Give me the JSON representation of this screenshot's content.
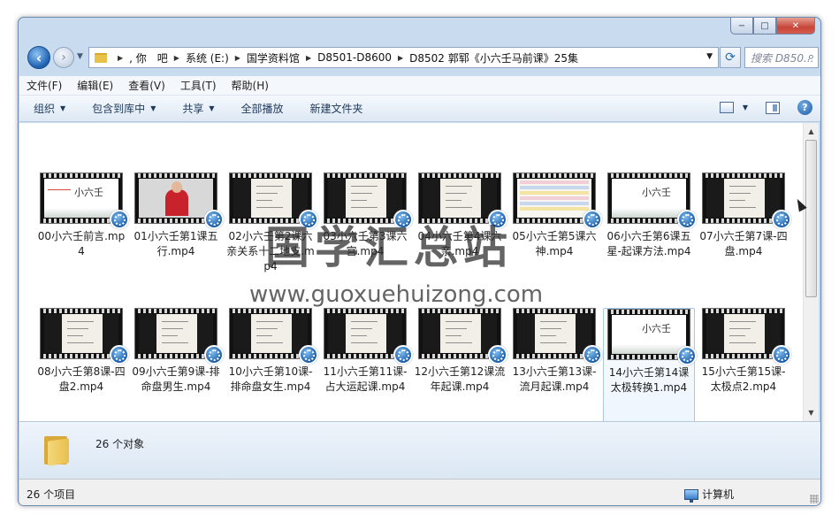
{
  "window": {
    "caption_buttons": {
      "minimize": "−",
      "maximize": "□",
      "close": "✕"
    }
  },
  "nav": {
    "back_icon": "back-arrow-icon",
    "forward_icon": "forward-arrow-icon",
    "breadcrumbs": [
      ", 你　吧",
      "系统 (E:)",
      "国学资料馆",
      "D8501-D8600",
      "D8502 郭郓《小六壬马前课》25集"
    ],
    "search_placeholder": "搜索 D850..."
  },
  "menubar": [
    "文件(F)",
    "编辑(E)",
    "查看(V)",
    "工具(T)",
    "帮助(H)"
  ],
  "toolbar": {
    "organize": "组织",
    "include_in_library": "包含到库中",
    "share": "共享",
    "play_all": "全部播放",
    "new_folder": "新建文件夹"
  },
  "files": [
    {
      "name": "00小六壬前言.mp4",
      "thumb": "title"
    },
    {
      "name": "01小六壬第1课五行.mp4",
      "thumb": "person"
    },
    {
      "name": "02小六壬第2课六亲关系十二地支.mp4",
      "thumb": "dark"
    },
    {
      "name": "03小六壬第3课六宫.mp4",
      "thumb": "dark"
    },
    {
      "name": "04小六壬第4课六亲.mp4",
      "thumb": "dark"
    },
    {
      "name": "05小六壬第5课六神.mp4",
      "thumb": "table"
    },
    {
      "name": "06小六壬第6课五星-起课方法.mp4",
      "thumb": "title2"
    },
    {
      "name": "07小六壬第7课-四盘.mp4",
      "thumb": "dark"
    },
    {
      "name": "08小六壬第8课-四盘2.mp4",
      "thumb": "dark"
    },
    {
      "name": "09小六壬第9课-排命盘男生.mp4",
      "thumb": "dark"
    },
    {
      "name": "10小六壬第10课-排命盘女生.mp4",
      "thumb": "dark"
    },
    {
      "name": "11小六壬第11课-占大运起课.mp4",
      "thumb": "dark"
    },
    {
      "name": "12小六壬第12课流年起课.mp4",
      "thumb": "dark"
    },
    {
      "name": "13小六壬第13课-流月起课.mp4",
      "thumb": "dark"
    },
    {
      "name": "14小六壬第14课太极转换1.mp4",
      "thumb": "title3",
      "selected": true
    },
    {
      "name": "15小六壬第15课-太极点2.mp4",
      "thumb": "dark"
    }
  ],
  "thumb_text": {
    "title_card": "小六壬"
  },
  "details": {
    "count": "26 个对象"
  },
  "status": {
    "left": "26 个项目",
    "right": "计算机"
  },
  "watermark": {
    "text": "国学汇总站",
    "url": "www.guoxuehuizong.com"
  },
  "colors": {
    "accent": "#1b5faa",
    "selection": "#a6c8ee",
    "close": "#c7463a"
  }
}
